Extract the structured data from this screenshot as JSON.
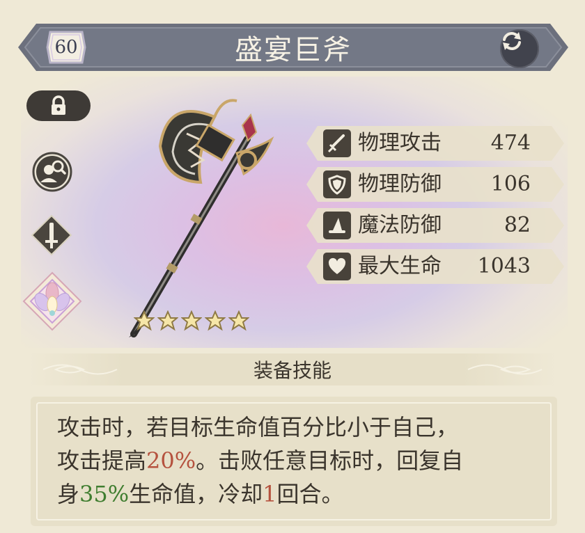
{
  "item": {
    "level": "60",
    "name": "盛宴巨斧",
    "rarity_stars": 5
  },
  "stats": [
    {
      "icon": "sword-icon",
      "label": "物理攻击",
      "value": "474"
    },
    {
      "icon": "shield-icon",
      "label": "物理防御",
      "value": "106"
    },
    {
      "icon": "wizard-hat-icon",
      "label": "魔法防御",
      "value": "82"
    },
    {
      "icon": "heart-icon",
      "label": "最大生命",
      "value": "1043"
    }
  ],
  "skill": {
    "header": "装备技能",
    "line1": "攻击时，若目标生命值百分比小于自己，",
    "line2_a": "攻击提高",
    "line2_b": "20%",
    "line2_c": "。击败任意目标时，回复自",
    "line3_a": "身",
    "line3_b": "35%",
    "line3_c": "生命值，冷却",
    "line3_d": "1",
    "line3_e": "回合。"
  },
  "colors": {
    "highlight_red": "#b5523e",
    "highlight_green": "#3f7d2f",
    "banner": "#6f7380",
    "panel": "#e7e0c9"
  }
}
